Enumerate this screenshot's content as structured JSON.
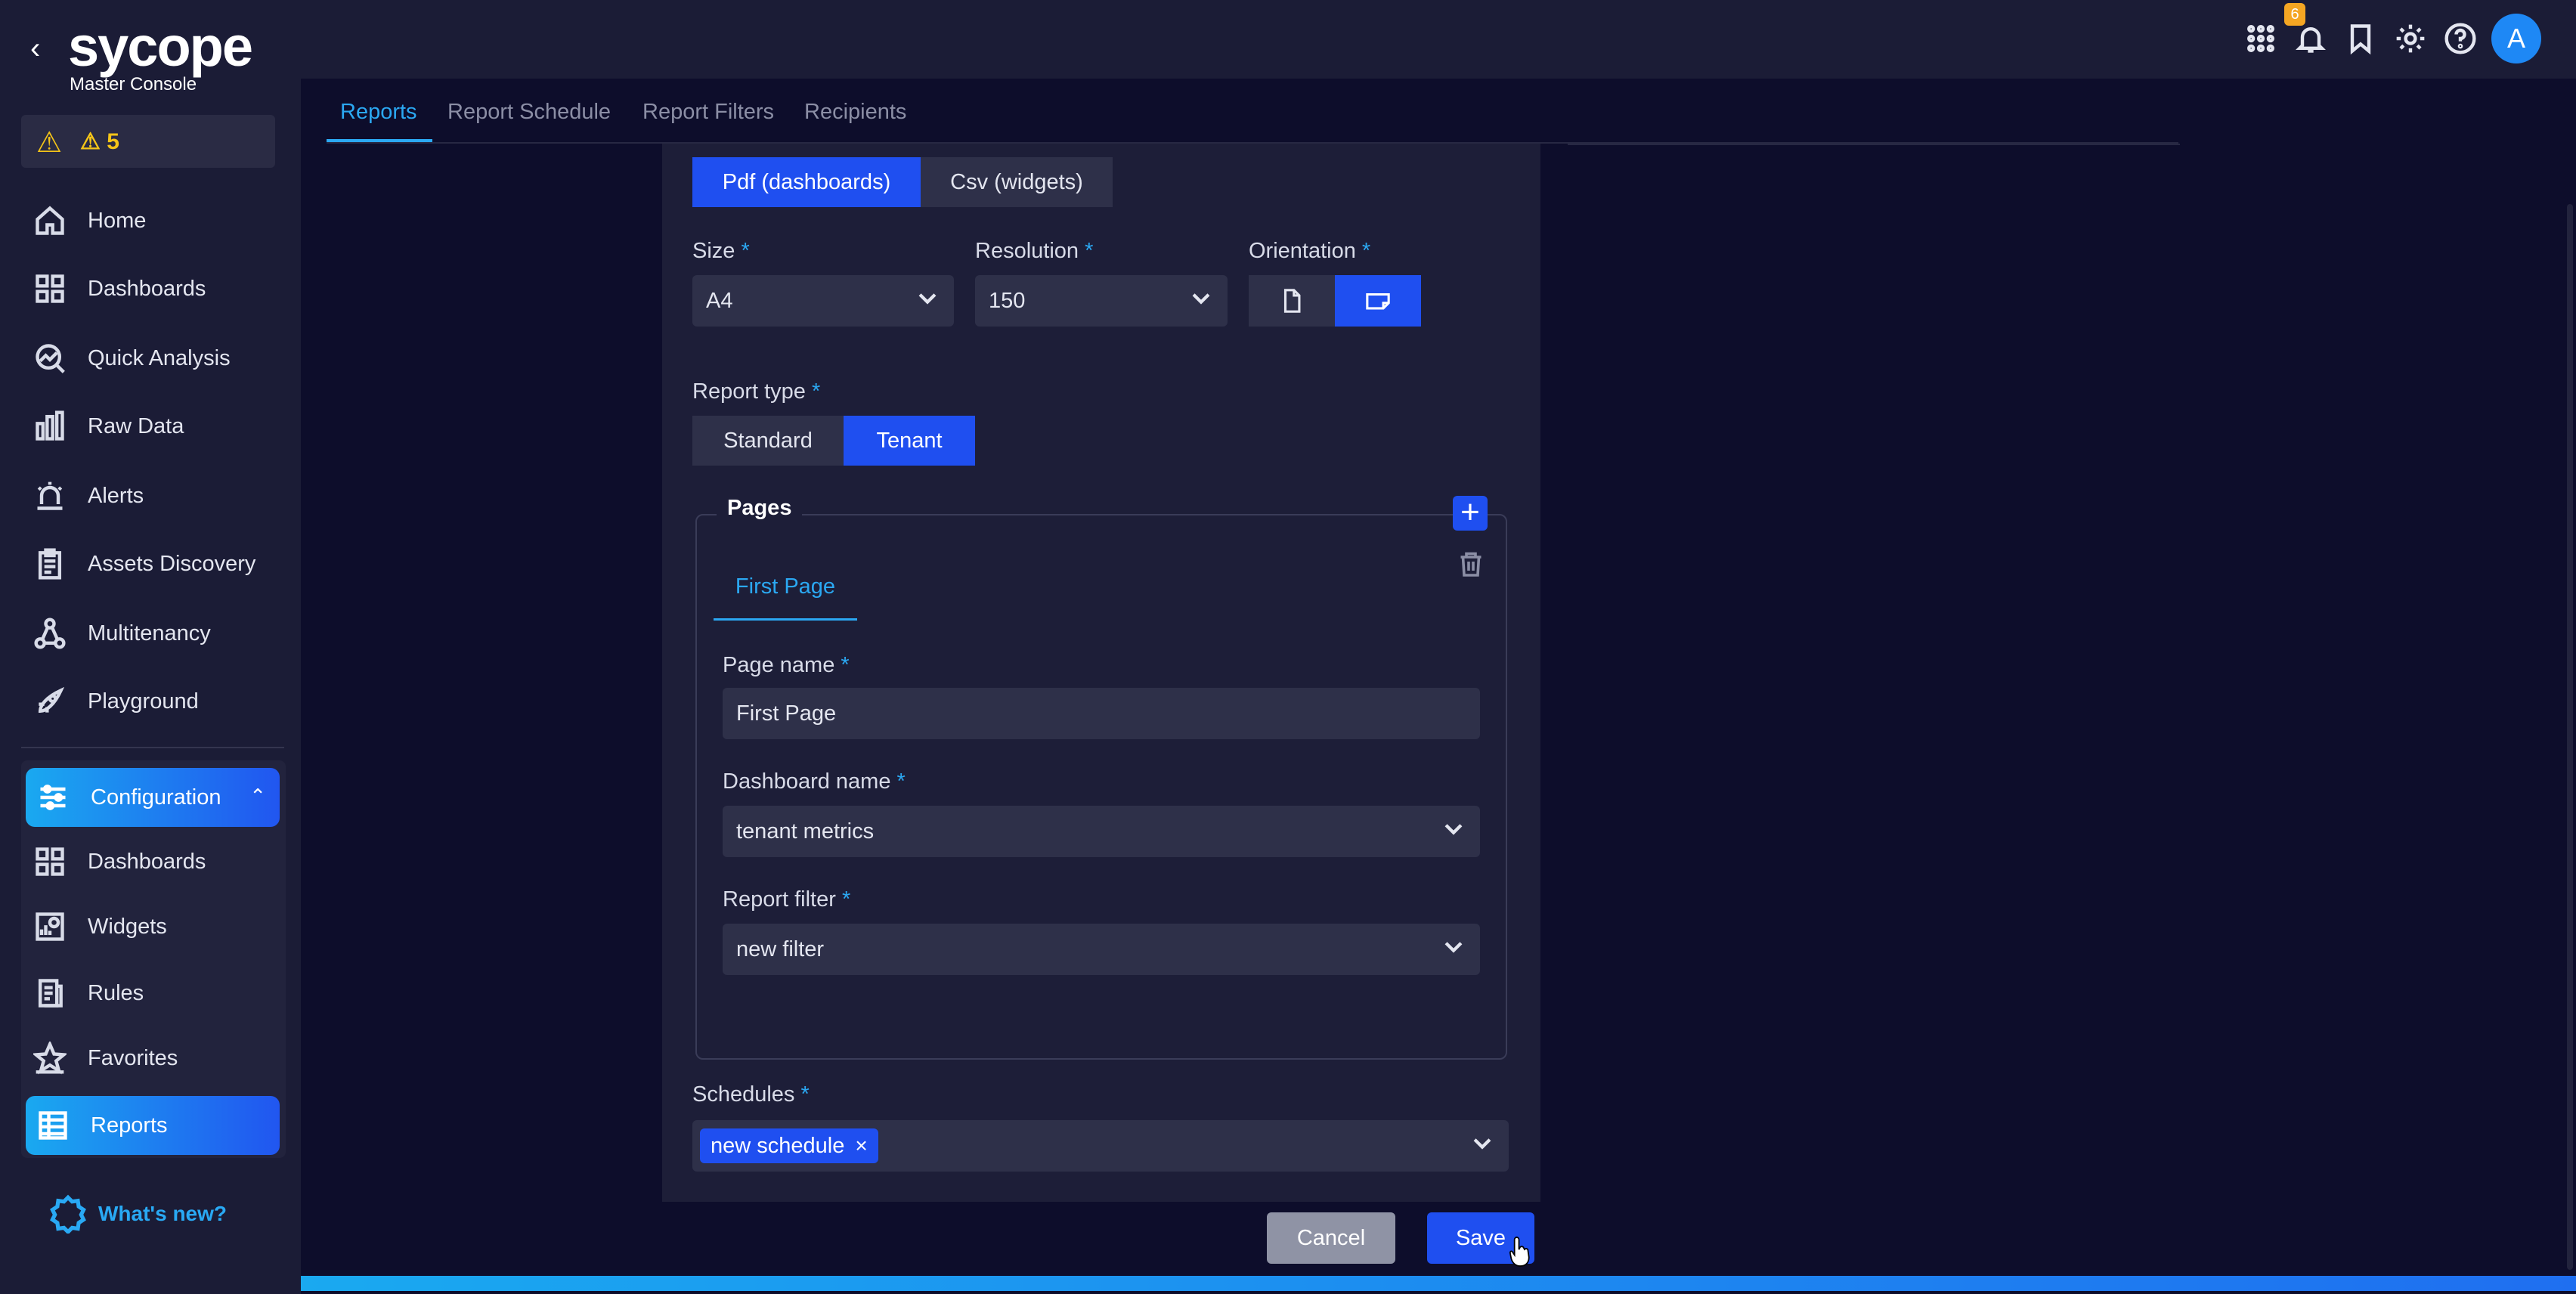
{
  "sidebar": {
    "back": "‹",
    "logo_text": "sycope",
    "logo_sub": "Master Console",
    "alert_count": "5",
    "items": [
      {
        "label": "Home"
      },
      {
        "label": "Dashboards"
      },
      {
        "label": "Quick Analysis"
      },
      {
        "label": "Raw Data"
      },
      {
        "label": "Alerts"
      },
      {
        "label": "Assets Discovery"
      },
      {
        "label": "Multitenancy"
      },
      {
        "label": "Playground"
      }
    ],
    "configuration": {
      "label": "Configuration",
      "items": [
        {
          "label": "Dashboards"
        },
        {
          "label": "Widgets"
        },
        {
          "label": "Rules"
        },
        {
          "label": "Favorites"
        },
        {
          "label": "Reports"
        }
      ]
    },
    "whats_new": "What's new?"
  },
  "topbar": {
    "notification_badge": "6",
    "avatar_initial": "A"
  },
  "tabs": [
    {
      "label": "Reports",
      "active": true
    },
    {
      "label": "Report Schedule"
    },
    {
      "label": "Report Filters"
    },
    {
      "label": "Recipients"
    }
  ],
  "form": {
    "format": {
      "options": [
        "Pdf (dashboards)",
        "Csv (widgets)"
      ],
      "selected": "Pdf (dashboards)"
    },
    "size": {
      "label": "Size",
      "value": "A4"
    },
    "resolution": {
      "label": "Resolution",
      "value": "150"
    },
    "orientation": {
      "label": "Orientation",
      "selected": "landscape"
    },
    "report_type": {
      "label": "Report type",
      "options": [
        "Standard",
        "Tenant"
      ],
      "selected": "Tenant"
    },
    "pages": {
      "legend": "Pages",
      "add": "+",
      "tab": "First Page",
      "page_name": {
        "label": "Page name",
        "value": "First Page"
      },
      "dashboard_name": {
        "label": "Dashboard name",
        "value": "tenant metrics"
      },
      "report_filter": {
        "label": "Report filter",
        "value": "new filter"
      }
    },
    "schedules": {
      "label": "Schedules",
      "chips": [
        "new schedule"
      ],
      "remove": "×"
    },
    "required_mark": "*",
    "cancel": "Cancel",
    "save": "Save"
  },
  "colors": {
    "accent": "#1f4ff0",
    "link": "#2ba8f2",
    "warning": "#f5c518",
    "badge": "#f5a623"
  }
}
